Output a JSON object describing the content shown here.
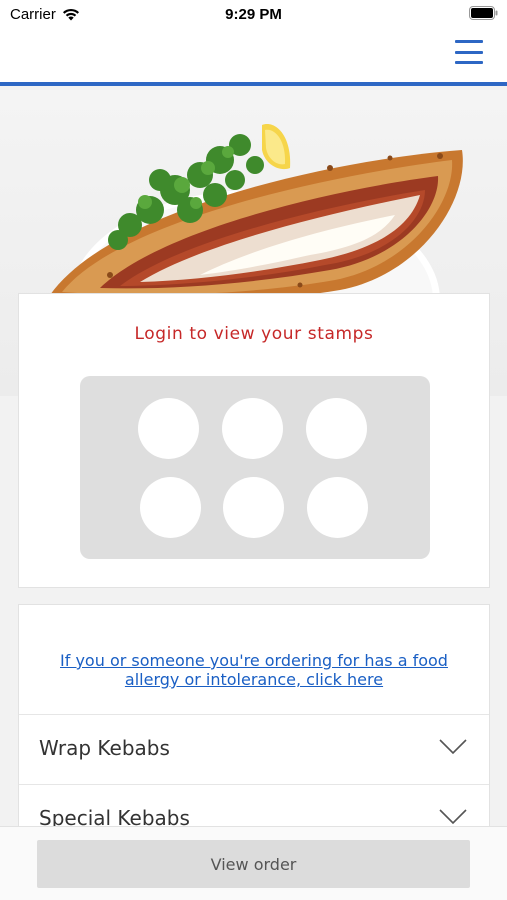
{
  "status_bar": {
    "carrier": "Carrier",
    "time": "9:29 PM",
    "wifi_icon": "wifi-icon",
    "battery_icon": "battery-icon"
  },
  "header": {
    "menu_icon": "hamburger-menu-icon",
    "accent_color": "#2d67c4"
  },
  "hero": {
    "image": "pide-flatbread-photo"
  },
  "stamps": {
    "title": "Login to view your stamps",
    "stamp_count": 6,
    "title_color": "#c62828"
  },
  "allergy": {
    "link_text": "If you or someone you're ordering for has a food allergy or intolerance, click here"
  },
  "menu_categories": [
    {
      "label": "Wrap Kebabs"
    },
    {
      "label": "Special Kebabs"
    }
  ],
  "bottom": {
    "view_order_label": "View order"
  }
}
